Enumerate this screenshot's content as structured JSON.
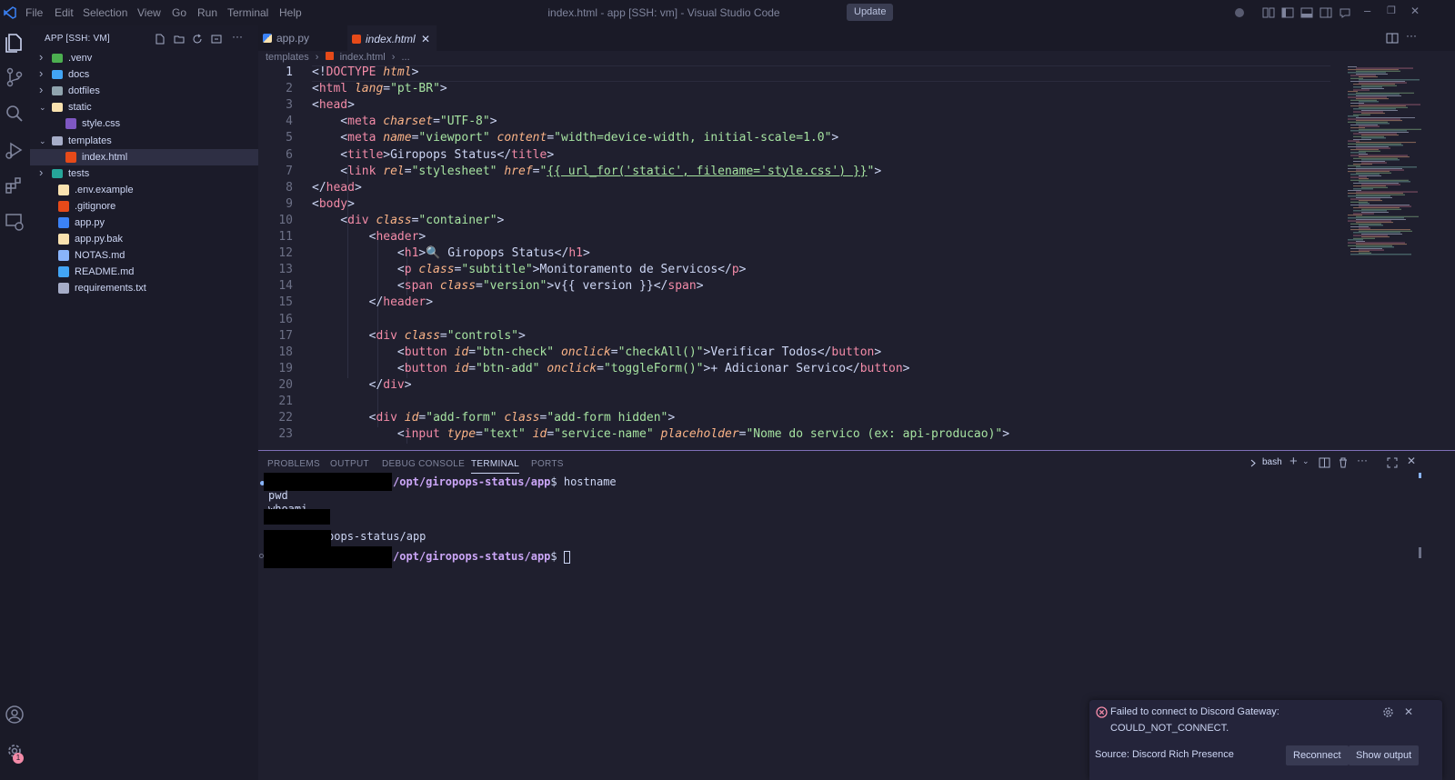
{
  "titlebar": {
    "menu": [
      "File",
      "Edit",
      "Selection",
      "View",
      "Go",
      "Run",
      "Terminal",
      "Help"
    ],
    "title": "index.html - app [SSH: vm] - Visual Studio Code",
    "update_label": "Update"
  },
  "sidebar": {
    "title": "APP [SSH: VM]",
    "items": [
      {
        "label": ".venv",
        "type": "folder",
        "expanded": false,
        "depth": 0,
        "icon": "folder-venv-icon",
        "color": "#4caf50"
      },
      {
        "label": "docs",
        "type": "folder",
        "expanded": false,
        "depth": 0,
        "icon": "folder-docs-icon",
        "color": "#42a5f5"
      },
      {
        "label": "dotfiles",
        "type": "folder",
        "expanded": false,
        "depth": 0,
        "icon": "folder-icon",
        "color": "#90a4ae"
      },
      {
        "label": "static",
        "type": "folder",
        "expanded": true,
        "depth": 0,
        "icon": "folder-static-icon",
        "color": "#f9e2af"
      },
      {
        "label": "style.css",
        "type": "file",
        "depth": 1,
        "icon": "css-file-icon",
        "color": "#7e57c2"
      },
      {
        "label": "templates",
        "type": "folder",
        "expanded": true,
        "depth": 0,
        "icon": "folder-templates-icon",
        "color": "#a6adc8"
      },
      {
        "label": "index.html",
        "type": "file",
        "depth": 1,
        "icon": "html-file-icon",
        "color": "#e64a19",
        "selected": true
      },
      {
        "label": "tests",
        "type": "folder",
        "expanded": false,
        "depth": 0,
        "icon": "folder-tests-icon",
        "color": "#26a69a"
      },
      {
        "label": ".env.example",
        "type": "file",
        "depth": 0,
        "icon": "env-file-icon",
        "color": "#f9e2af"
      },
      {
        "label": ".gitignore",
        "type": "file",
        "depth": 0,
        "icon": "git-file-icon",
        "color": "#e64a19"
      },
      {
        "label": "app.py",
        "type": "file",
        "depth": 0,
        "icon": "python-file-icon",
        "color": "#3b82f6"
      },
      {
        "label": "app.py.bak",
        "type": "file",
        "depth": 0,
        "icon": "backup-file-icon",
        "color": "#f9e2af"
      },
      {
        "label": "NOTAS.md",
        "type": "file",
        "depth": 0,
        "icon": "markdown-file-icon",
        "color": "#89b4fa"
      },
      {
        "label": "README.md",
        "type": "file",
        "depth": 0,
        "icon": "info-file-icon",
        "color": "#42a5f5"
      },
      {
        "label": "requirements.txt",
        "type": "file",
        "depth": 0,
        "icon": "text-file-icon",
        "color": "#a6adc8"
      }
    ]
  },
  "tabs": [
    {
      "label": "app.py",
      "icon": "python-file-icon",
      "active": false
    },
    {
      "label": "index.html",
      "icon": "html-file-icon",
      "active": true
    }
  ],
  "breadcrumb": {
    "folder": "templates",
    "file": "index.html",
    "more": "..."
  },
  "editor": {
    "lines": [
      [
        [
          "p",
          "<!"
        ],
        [
          "t",
          "DOCTYPE"
        ],
        [
          "p",
          " "
        ],
        [
          "a",
          "html"
        ],
        [
          "p",
          ">"
        ]
      ],
      [
        [
          "p",
          "<"
        ],
        [
          "t",
          "html"
        ],
        [
          "p",
          " "
        ],
        [
          "a",
          "lang"
        ],
        [
          "p",
          "="
        ],
        [
          "s",
          "\"pt-BR\""
        ],
        [
          "p",
          ">"
        ]
      ],
      [
        [
          "p",
          "<"
        ],
        [
          "t",
          "head"
        ],
        [
          "p",
          ">"
        ]
      ],
      [
        [
          "p",
          "    <"
        ],
        [
          "t",
          "meta"
        ],
        [
          "p",
          " "
        ],
        [
          "a",
          "charset"
        ],
        [
          "p",
          "="
        ],
        [
          "s",
          "\"UTF-8\""
        ],
        [
          "p",
          ">"
        ]
      ],
      [
        [
          "p",
          "    <"
        ],
        [
          "t",
          "meta"
        ],
        [
          "p",
          " "
        ],
        [
          "a",
          "name"
        ],
        [
          "p",
          "="
        ],
        [
          "s",
          "\"viewport\""
        ],
        [
          "p",
          " "
        ],
        [
          "a",
          "content"
        ],
        [
          "p",
          "="
        ],
        [
          "s",
          "\"width=device-width, initial-scale=1.0\""
        ],
        [
          "p",
          ">"
        ]
      ],
      [
        [
          "p",
          "    <"
        ],
        [
          "t",
          "title"
        ],
        [
          "p",
          ">Giropops Status</"
        ],
        [
          "t",
          "title"
        ],
        [
          "p",
          ">"
        ]
      ],
      [
        [
          "p",
          "    <"
        ],
        [
          "t",
          "link"
        ],
        [
          "p",
          " "
        ],
        [
          "a",
          "rel"
        ],
        [
          "p",
          "="
        ],
        [
          "s",
          "\"stylesheet\""
        ],
        [
          "p",
          " "
        ],
        [
          "a",
          "href"
        ],
        [
          "p",
          "="
        ],
        [
          "s",
          "\""
        ],
        [
          "u",
          "{{ url_for('static', filename='style.css') }}"
        ],
        [
          "s",
          "\""
        ],
        [
          "p",
          ">"
        ]
      ],
      [
        [
          "p",
          "</"
        ],
        [
          "t",
          "head"
        ],
        [
          "p",
          ">"
        ]
      ],
      [
        [
          "p",
          "<"
        ],
        [
          "t",
          "body"
        ],
        [
          "p",
          ">"
        ]
      ],
      [
        [
          "p",
          "    <"
        ],
        [
          "t",
          "div"
        ],
        [
          "p",
          " "
        ],
        [
          "a",
          "class"
        ],
        [
          "p",
          "="
        ],
        [
          "s",
          "\"container\""
        ],
        [
          "p",
          ">"
        ]
      ],
      [
        [
          "p",
          "        <"
        ],
        [
          "t",
          "header"
        ],
        [
          "p",
          ">"
        ]
      ],
      [
        [
          "p",
          "            <"
        ],
        [
          "t",
          "h1"
        ],
        [
          "p",
          ">🔍 Giropops Status</"
        ],
        [
          "t",
          "h1"
        ],
        [
          "p",
          ">"
        ]
      ],
      [
        [
          "p",
          "            <"
        ],
        [
          "t",
          "p"
        ],
        [
          "p",
          " "
        ],
        [
          "a",
          "class"
        ],
        [
          "p",
          "="
        ],
        [
          "s",
          "\"subtitle\""
        ],
        [
          "p",
          ">Monitoramento de Servicos</"
        ],
        [
          "t",
          "p"
        ],
        [
          "p",
          ">"
        ]
      ],
      [
        [
          "p",
          "            <"
        ],
        [
          "t",
          "span"
        ],
        [
          "p",
          " "
        ],
        [
          "a",
          "class"
        ],
        [
          "p",
          "="
        ],
        [
          "s",
          "\"version\""
        ],
        [
          "p",
          ">v{{ version }}</"
        ],
        [
          "t",
          "span"
        ],
        [
          "p",
          ">"
        ]
      ],
      [
        [
          "p",
          "        </"
        ],
        [
          "t",
          "header"
        ],
        [
          "p",
          ">"
        ]
      ],
      [
        [
          "p",
          ""
        ]
      ],
      [
        [
          "p",
          "        <"
        ],
        [
          "t",
          "div"
        ],
        [
          "p",
          " "
        ],
        [
          "a",
          "class"
        ],
        [
          "p",
          "="
        ],
        [
          "s",
          "\"controls\""
        ],
        [
          "p",
          ">"
        ]
      ],
      [
        [
          "p",
          "            <"
        ],
        [
          "t",
          "button"
        ],
        [
          "p",
          " "
        ],
        [
          "a",
          "id"
        ],
        [
          "p",
          "="
        ],
        [
          "s",
          "\"btn-check\""
        ],
        [
          "p",
          " "
        ],
        [
          "a",
          "onclick"
        ],
        [
          "p",
          "="
        ],
        [
          "s",
          "\"checkAll()\""
        ],
        [
          "p",
          ">Verificar Todos</"
        ],
        [
          "t",
          "button"
        ],
        [
          "p",
          ">"
        ]
      ],
      [
        [
          "p",
          "            <"
        ],
        [
          "t",
          "button"
        ],
        [
          "p",
          " "
        ],
        [
          "a",
          "id"
        ],
        [
          "p",
          "="
        ],
        [
          "s",
          "\"btn-add\""
        ],
        [
          "p",
          " "
        ],
        [
          "a",
          "onclick"
        ],
        [
          "p",
          "="
        ],
        [
          "s",
          "\"toggleForm()\""
        ],
        [
          "p",
          ">+ Adicionar Servico</"
        ],
        [
          "t",
          "button"
        ],
        [
          "p",
          ">"
        ]
      ],
      [
        [
          "p",
          "        </"
        ],
        [
          "t",
          "div"
        ],
        [
          "p",
          ">"
        ]
      ],
      [
        [
          "p",
          ""
        ]
      ],
      [
        [
          "p",
          "        <"
        ],
        [
          "t",
          "div"
        ],
        [
          "p",
          " "
        ],
        [
          "a",
          "id"
        ],
        [
          "p",
          "="
        ],
        [
          "s",
          "\"add-form\""
        ],
        [
          "p",
          " "
        ],
        [
          "a",
          "class"
        ],
        [
          "p",
          "="
        ],
        [
          "s",
          "\"add-form hidden\""
        ],
        [
          "p",
          ">"
        ]
      ],
      [
        [
          "p",
          "            <"
        ],
        [
          "t",
          "input"
        ],
        [
          "p",
          " "
        ],
        [
          "a",
          "type"
        ],
        [
          "p",
          "="
        ],
        [
          "s",
          "\"text\""
        ],
        [
          "p",
          " "
        ],
        [
          "a",
          "id"
        ],
        [
          "p",
          "="
        ],
        [
          "s",
          "\"service-name\""
        ],
        [
          "p",
          " "
        ],
        [
          "a",
          "placeholder"
        ],
        [
          "p",
          "="
        ],
        [
          "s",
          "\"Nome do servico (ex: api-producao)\""
        ],
        [
          "p",
          ">"
        ]
      ]
    ]
  },
  "panel": {
    "tabs": [
      "PROBLEMS",
      "OUTPUT",
      "DEBUG CONSOLE",
      "TERMINAL",
      "PORTS"
    ],
    "active_tab": "TERMINAL",
    "shell": "bash",
    "terminal": {
      "line1_path": "/opt/giropops-status/app",
      "line1_cmd": "hostname",
      "line2": "pwd",
      "line3": "whoami",
      "line4": "/opt/giropops-status/app",
      "line5_path": "/opt/giropops-status/app"
    }
  },
  "notification": {
    "message_line1": "Failed to connect to Discord Gateway:",
    "message_line2": "COULD_NOT_CONNECT.",
    "source": "Source: Discord Rich Presence",
    "reconnect_label": "Reconnect",
    "show_output_label": "Show output"
  }
}
